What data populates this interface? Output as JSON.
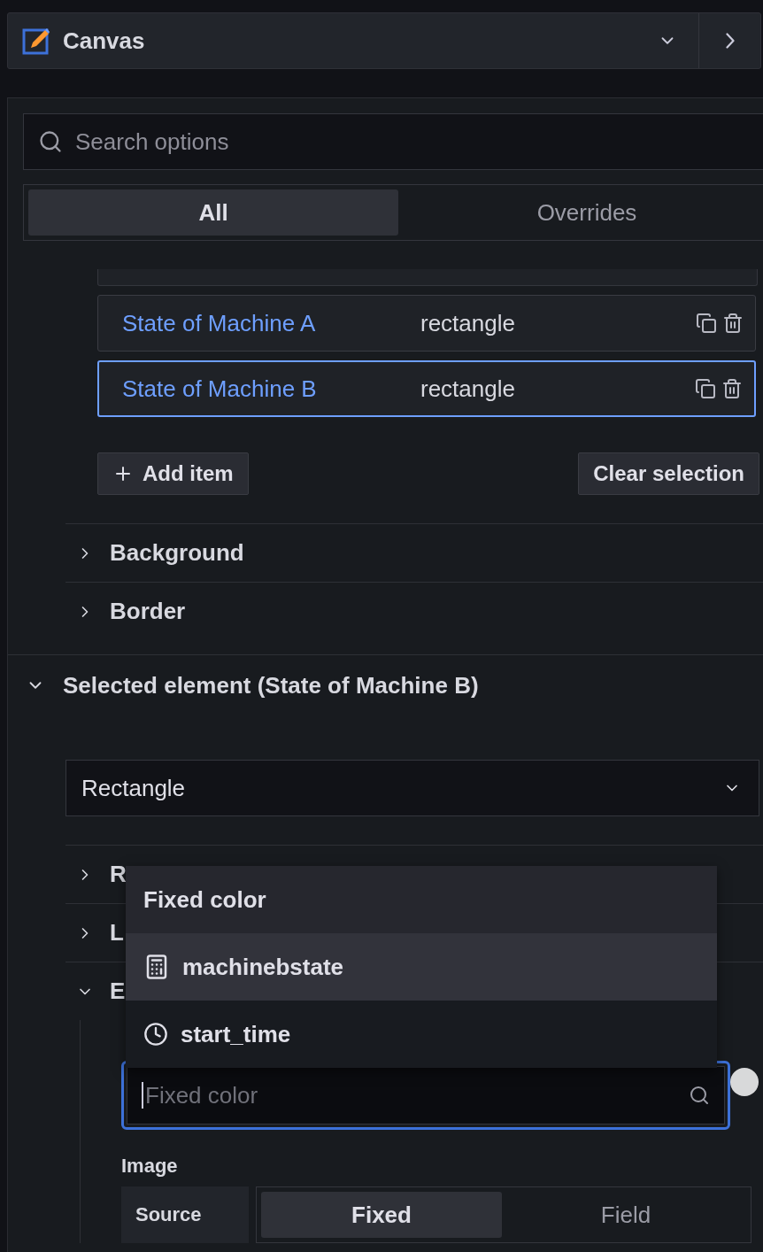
{
  "header": {
    "title": "Canvas"
  },
  "search": {
    "placeholder": "Search options"
  },
  "tabs": [
    {
      "label": "All",
      "selected": true
    },
    {
      "label": "Overrides",
      "selected": false
    }
  ],
  "elements": [
    {
      "name": "State of Machine A",
      "type": "rectangle",
      "selected": false
    },
    {
      "name": "State of Machine B",
      "type": "rectangle",
      "selected": true
    }
  ],
  "add_button": "Add item",
  "clear_button": "Clear selection",
  "sections": [
    {
      "label": "Background",
      "expanded": false
    },
    {
      "label": "Border",
      "expanded": false
    }
  ],
  "selected_element": {
    "title": "Selected element (State of Machine B)",
    "expanded": true,
    "type_value": "Rectangle",
    "subsections": [
      {
        "label": "R",
        "expanded": false
      },
      {
        "label": "L",
        "expanded": false
      },
      {
        "label": "E",
        "expanded": true
      }
    ],
    "color_field": {
      "placeholder": "Fixed color"
    },
    "image_label": "Image",
    "source_label": "Source",
    "source_options": [
      {
        "label": "Fixed",
        "selected": true
      },
      {
        "label": "Field",
        "selected": false
      }
    ]
  },
  "dropdown": [
    {
      "label": "Fixed color",
      "kind": "plain",
      "selected": false
    },
    {
      "label": "machinebstate",
      "kind": "number",
      "selected": true
    },
    {
      "label": "start_time",
      "kind": "time",
      "selected": false
    }
  ]
}
